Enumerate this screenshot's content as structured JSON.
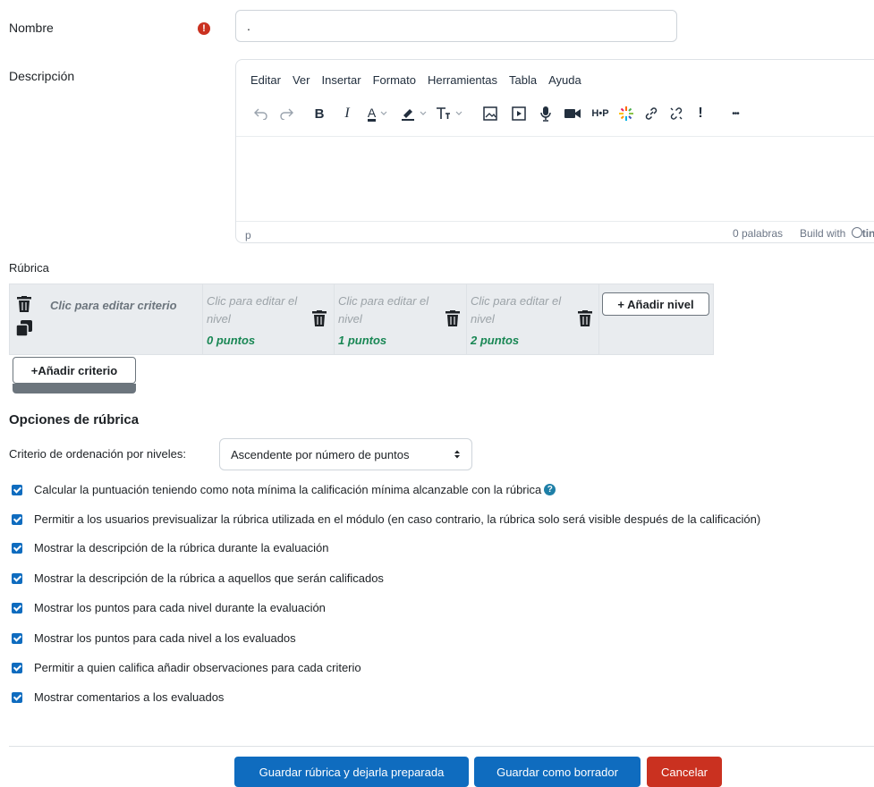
{
  "form": {
    "name_label": "Nombre",
    "name_value": ".",
    "required_icon": "!",
    "description_label": "Descripción"
  },
  "editor": {
    "menu": [
      "Editar",
      "Ver",
      "Insertar",
      "Formato",
      "Herramientas",
      "Tabla",
      "Ayuda"
    ],
    "bold_label": "B",
    "italic_label": "I",
    "text_color_label": "A",
    "h5p_label": "H•P",
    "more_label": "•••",
    "status_path": "p",
    "word_count": "0 palabras",
    "build_with": "Build with",
    "brand": "tinyMCE"
  },
  "rubric": {
    "label": "Rúbrica",
    "criterion_placeholder": "Clic para editar criterio",
    "levels": [
      {
        "text": "Clic para editar el nivel",
        "points": "0 puntos"
      },
      {
        "text": "Clic para editar el nivel",
        "points": "1 puntos"
      },
      {
        "text": "Clic para editar el nivel",
        "points": "2 puntos"
      }
    ],
    "add_level": "+ Añadir nivel",
    "add_criterion": "+Añadir criterio"
  },
  "options": {
    "heading": "Opciones de rúbrica",
    "sort_label": "Criterio de ordenación por niveles:",
    "sort_value": "Ascendente por número de puntos",
    "checkboxes": [
      {
        "label": "Calcular la puntuación teniendo como nota mínima la calificación mínima alcanzable con la rúbrica",
        "checked": true
      },
      {
        "label": "Permitir a los usuarios previsualizar la rúbrica utilizada en el módulo (en caso contrario, la rúbrica solo será visible después de la calificación)",
        "checked": true
      },
      {
        "label": "Mostrar la descripción de la rúbrica durante la evaluación",
        "checked": true
      },
      {
        "label": "Mostrar la descripción de la rúbrica a aquellos que serán calificados",
        "checked": true
      },
      {
        "label": "Mostrar los puntos para cada nivel durante la evaluación",
        "checked": true
      },
      {
        "label": "Mostrar los puntos para cada nivel a los evaluados",
        "checked": true
      },
      {
        "label": "Permitir a quien califica añadir observaciones para cada criterio",
        "checked": true
      },
      {
        "label": "Mostrar comentarios a los evaluados",
        "checked": true
      }
    ]
  },
  "actions": {
    "save_ready": "Guardar rúbrica y dejarla preparada",
    "save_draft": "Guardar como borrador",
    "cancel": "Cancelar"
  },
  "colors": {
    "primary": "#0f6cbf",
    "danger": "#ca3120",
    "points_green": "#198754"
  }
}
